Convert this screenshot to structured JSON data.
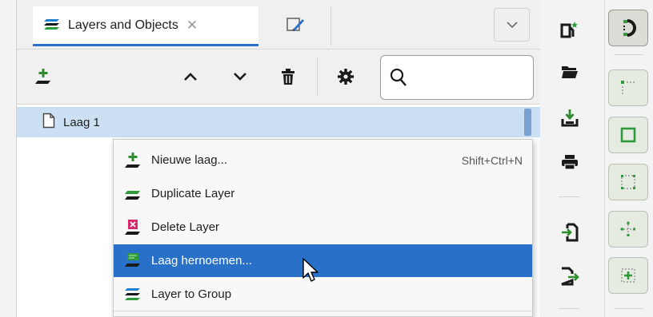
{
  "tabs": {
    "layers_label": "Layers and Objects",
    "close_glyph": "✕",
    "dropdown_glyph": "⌄"
  },
  "search": {
    "value": "",
    "placeholder": ""
  },
  "tree": {
    "layer_name": "Laag 1"
  },
  "context_menu": {
    "items": [
      {
        "label": "Nieuwe laag...",
        "shortcut": "Shift+Ctrl+N",
        "icon": "new-layer-icon"
      },
      {
        "label": "Duplicate Layer",
        "shortcut": "",
        "icon": "duplicate-layer-icon"
      },
      {
        "label": "Delete Layer",
        "shortcut": "",
        "icon": "delete-layer-icon"
      },
      {
        "label": "Laag hernoemen...",
        "shortcut": "",
        "icon": "rename-layer-icon",
        "highlighted": true
      },
      {
        "label": "Layer to Group",
        "shortcut": "",
        "icon": "layer-to-group-icon"
      }
    ]
  },
  "colors": {
    "accent": "#2971c8",
    "selection": "#cce0f3",
    "green_icon": "#2e8b2e",
    "pink_icon": "#d6286f"
  }
}
